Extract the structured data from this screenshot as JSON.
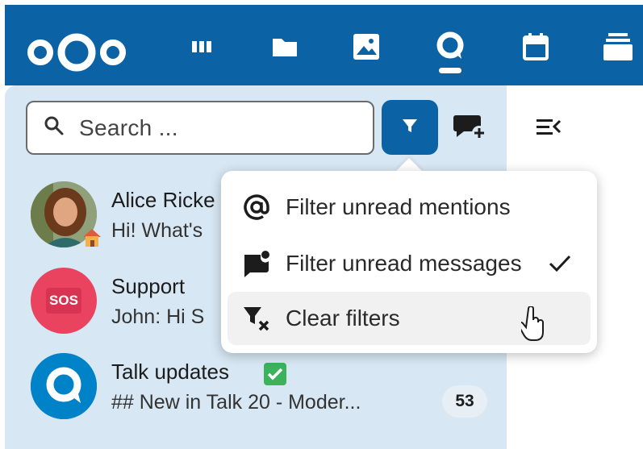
{
  "topbar": {
    "background": "#0b62a4",
    "apps": [
      {
        "name": "dashboard-icon"
      },
      {
        "name": "files-icon"
      },
      {
        "name": "photos-icon"
      },
      {
        "name": "talk-icon",
        "active": true
      },
      {
        "name": "calendar-icon"
      },
      {
        "name": "deck-icon"
      }
    ]
  },
  "search": {
    "placeholder": "Search ..."
  },
  "conversations": [
    {
      "name": "Alice Ricke",
      "message": "Hi! What's",
      "avatar": "photo",
      "status_icon": "house-icon"
    },
    {
      "name": "Support",
      "message": "John: Hi S",
      "avatar_text": "SOS",
      "avatar_color": "#e9435f"
    },
    {
      "name": "Talk updates",
      "message": "## New in Talk 20 - Moder...",
      "unread_count": "53",
      "verified_icon": "check-badge-icon",
      "avatar_color": "#0082c9"
    }
  ],
  "filter_menu": {
    "items": [
      {
        "label": "Filter unread mentions",
        "icon": "at-icon",
        "checked": false
      },
      {
        "label": "Filter unread messages",
        "icon": "message-alert-icon",
        "checked": true
      },
      {
        "label": "Clear filters",
        "icon": "filter-remove-icon",
        "checked": false,
        "hovered": true
      }
    ]
  },
  "colors": {
    "accent": "#0b62a4",
    "sidebar": "#d7e7f3"
  }
}
